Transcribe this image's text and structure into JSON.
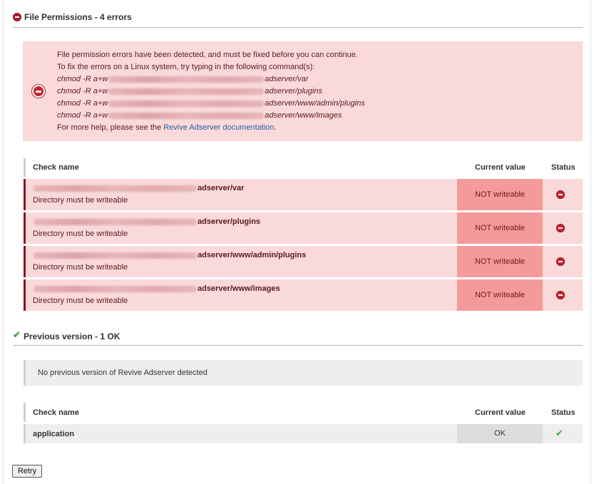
{
  "sections": {
    "file_permissions": {
      "title": "File Permissions - 4 errors"
    },
    "previous_version": {
      "title": "Previous version - 1 OK"
    }
  },
  "error_box": {
    "line1": "File permission errors have been detected, and must be fixed before you can continue.",
    "line2": "To fix the errors on a Linux system, try typing in the following command(s):",
    "cmd_prefix": "chmod -R a+w",
    "commands": [
      "adserver/var",
      "adserver/plugins",
      "adserver/www/admin/plugins",
      "adserver/www/images"
    ],
    "help_prefix": "For more help, please see the ",
    "help_link": "Revive Adserver documentation",
    "help_suffix": "."
  },
  "perm_table": {
    "col_name": "Check name",
    "col_value": "Current value",
    "col_status": "Status",
    "rows": [
      {
        "path": "adserver/var",
        "desc": "Directory must be writeable",
        "value": "NOT writeable"
      },
      {
        "path": "adserver/plugins",
        "desc": "Directory must be writeable",
        "value": "NOT writeable"
      },
      {
        "path": "adserver/www/admin/plugins",
        "desc": "Directory must be writeable",
        "value": "NOT writeable"
      },
      {
        "path": "adserver/www/images",
        "desc": "Directory must be writeable",
        "value": "NOT writeable"
      }
    ]
  },
  "info": {
    "text": "No previous version of Revive Adserver detected"
  },
  "version_table": {
    "col_name": "Check name",
    "col_value": "Current value",
    "col_status": "Status",
    "rows": [
      {
        "name": "application",
        "value": "OK"
      }
    ]
  },
  "retry_label": "Retry",
  "colors": {
    "error": "#c8232f",
    "error_bg": "#f9d9da",
    "value_bg": "#f59a9a",
    "ok": "#4aa24a"
  },
  "icons": {
    "error": "error-circle-icon",
    "ok": "checkmark-icon"
  }
}
